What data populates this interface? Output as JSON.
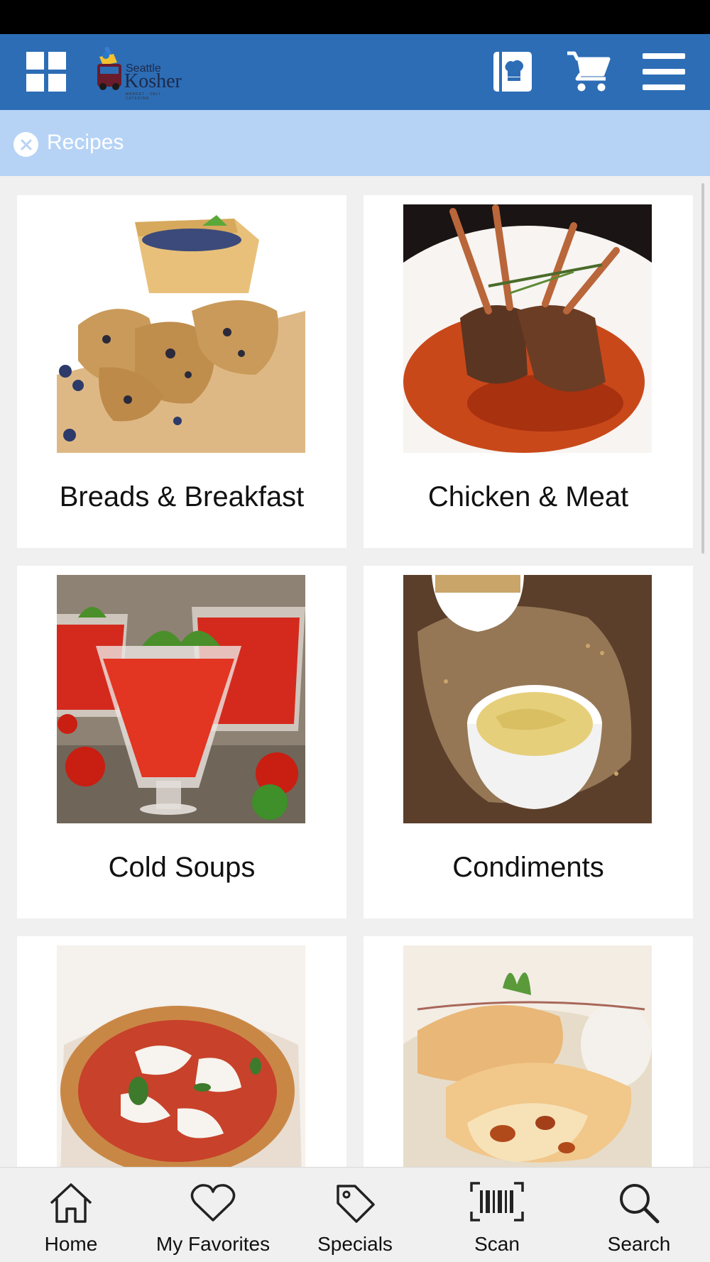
{
  "header": {
    "logo": {
      "line1": "Seattle",
      "line2": "Kosher",
      "tagline": "MARKET · DELI · CATERING"
    },
    "icons": {
      "menu_grid": "grid-icon",
      "recipe_box": "recipe-book-icon",
      "cart": "cart-icon",
      "hamburger": "hamburger-menu-icon"
    },
    "colors": {
      "header_bg": "#2d6db5",
      "breadcrumb_bg": "#b6d3f6"
    }
  },
  "breadcrumb": {
    "label": "Recipes",
    "close_icon": "close-icon"
  },
  "categories": [
    {
      "label": "Breads & Breakfast",
      "image": "blueberry-scones"
    },
    {
      "label": "Chicken & Meat",
      "image": "rack-of-lamb"
    },
    {
      "label": "Cold Soups",
      "image": "gazpacho-glasses"
    },
    {
      "label": "Condiments",
      "image": "mustard-bowl"
    },
    {
      "label": "",
      "image": "pizza"
    },
    {
      "label": "",
      "image": "strudel"
    }
  ],
  "tabs": [
    {
      "label": "Home",
      "icon": "home-icon"
    },
    {
      "label": "My Favorites",
      "icon": "heart-icon"
    },
    {
      "label": "Specials",
      "icon": "tag-icon"
    },
    {
      "label": "Scan",
      "icon": "barcode-icon"
    },
    {
      "label": "Search",
      "icon": "search-icon"
    }
  ]
}
